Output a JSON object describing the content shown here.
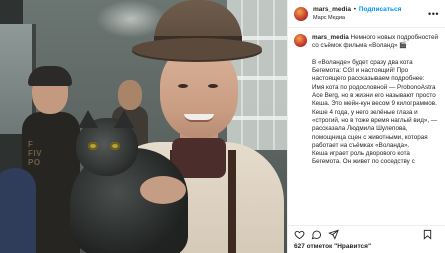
{
  "header": {
    "username": "mars_media",
    "separator": "•",
    "follow_label": "Подписаться",
    "location": "Марс Медиа",
    "more_icon": "more-horizontal-icon"
  },
  "photo": {
    "shirt_print": "F\nFIV\nPO"
  },
  "caption": {
    "username": "mars_media",
    "text": " Немного новых подробностей со съёмок фильма «Воланд» 🎬\n\nВ «Воланде» будет сразу два кота Бегемота: CGI и настоящий! Про настоящего рассказываем подробнее:\nИмя кота по родословной — ProbonoAstra Ace Berg, но в жизни его называют просто Кеша. Это мейн-кун весом 9 килограммов. Кеше 4 года, у него зелёные глаза и «строгий, но в тоже время наглый вид», — рассказала Людмила Шулепова, помощница сцен с животными, которая работает на съёмках «Воланда».\nКеша играет роль дворового кота Бегемота. Он живет по соседству с"
  },
  "actions": {
    "like_icon": "heart-icon",
    "comment_icon": "comment-icon",
    "share_icon": "share-icon",
    "save_icon": "bookmark-icon"
  },
  "likes": {
    "text": "627 отметок \"Нравится\""
  }
}
